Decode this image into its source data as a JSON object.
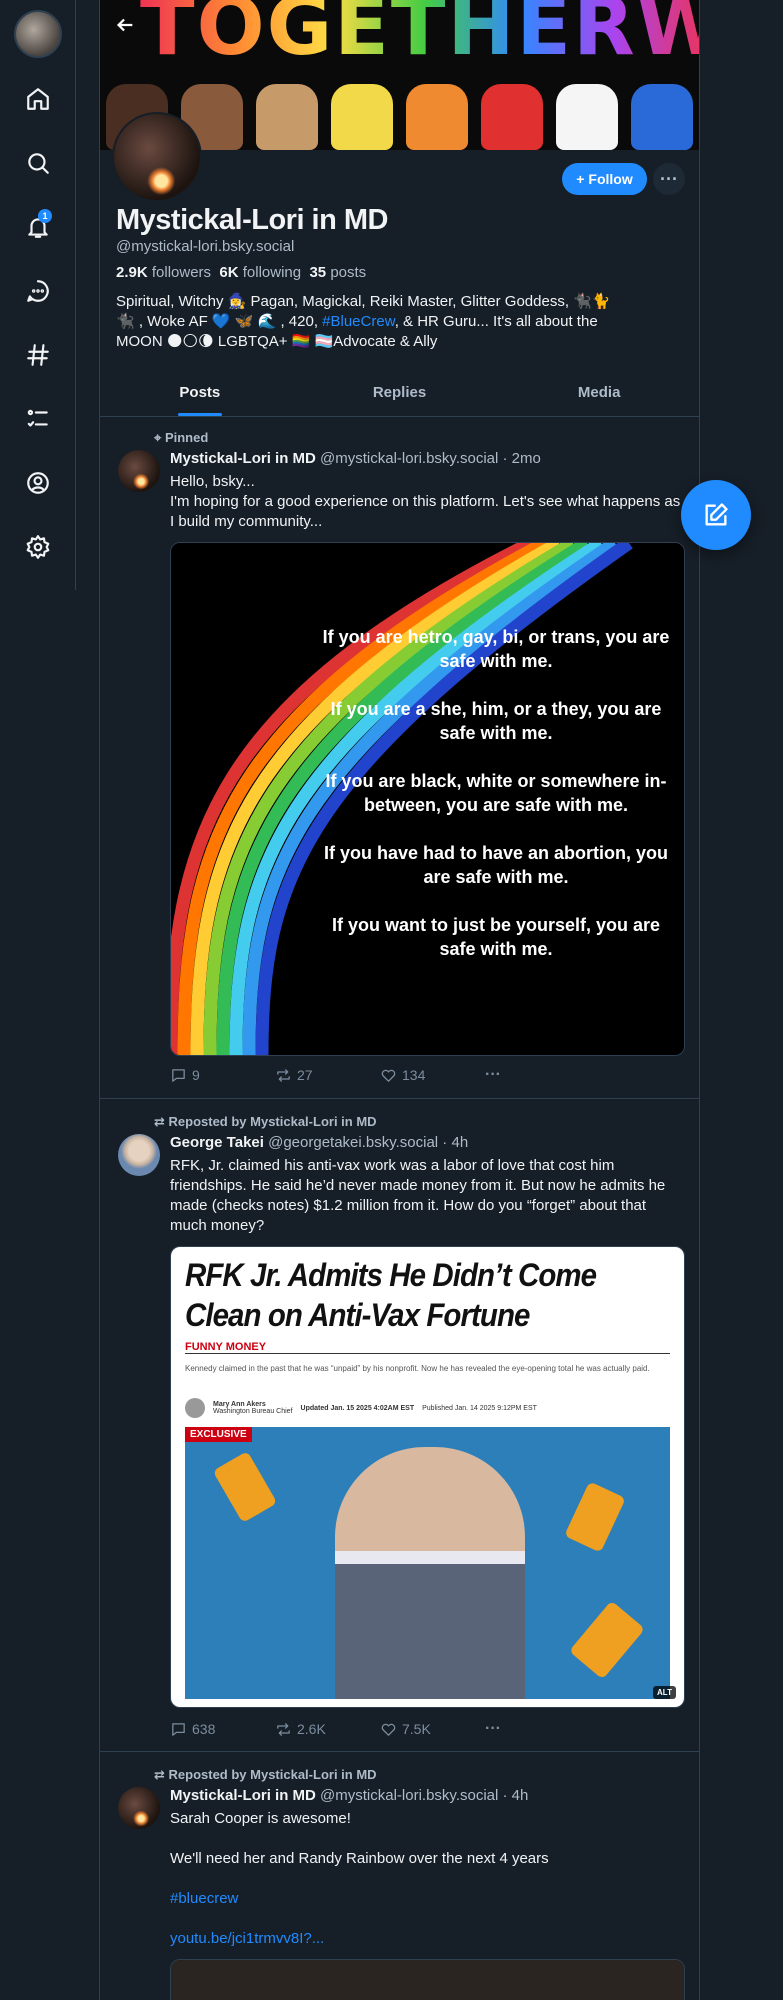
{
  "sidebar": {
    "notification_count": "1"
  },
  "profile": {
    "display_name": "Mystickal-Lori in MD",
    "handle": "@mystickal-lori.bsky.social",
    "followers_count": "2.9K",
    "followers_label": "followers",
    "following_count": "6K",
    "following_label": "following",
    "posts_count": "35",
    "posts_label": "posts",
    "follow_label": "Follow",
    "bio_line1": "Spiritual, Witchy 🧙‍♀️ Pagan, Magickal, Reiki Master,  Glitter Goddess, 🐈‍⬛🐈",
    "bio_line2_a": "🐈‍⬛ , Woke AF 💙 🦋 🌊 , 420, ",
    "bio_hashtag": "#BlueCrew",
    "bio_line2_b": ", & HR  Guru... It's all about the",
    "bio_line3": "MOON 🌑🌕🌘 LGBTQA+ 🏳️‍🌈 🏳️‍⚧️Advocate & Ally"
  },
  "tabs": [
    "Posts",
    "Replies",
    "Media"
  ],
  "posts": [
    {
      "context": "Pinned",
      "author": "Mystickal-Lori in MD",
      "handle": "@mystickal-lori.bsky.social · 2mo",
      "text_line1": "Hello, bsky...",
      "text_line2": "I'm hoping for a good experience on this platform. Let's see what happens as I build my community...",
      "image_lines": [
        "If you are hetro, gay, bi, or trans, you are safe with me.",
        "If you are a she, him, or a they, you are safe with me.",
        "If you are black, white or somewhere in-between, you are safe with me.",
        "If you have had to have an abortion, you are safe with me.",
        "If you want to just be yourself, you are safe with me."
      ],
      "replies": "9",
      "reposts": "27",
      "likes": "134"
    },
    {
      "context": "Reposted by Mystickal-Lori in MD",
      "author": "George Takei",
      "handle": "@georgetakei.bsky.social · 4h",
      "text": "RFK, Jr. claimed his anti-vax work was a labor of love that cost him friendships. He said he’d never made money from it. But now he admits he made (checks notes) $1.2 million from it. How do you “forget” about that much money?",
      "news_title": "RFK Jr. Admits He Didn’t Come Clean on Anti-Vax Fortune",
      "news_section": "FUNNY MONEY",
      "news_dek": "Kennedy claimed in the past that he was “unpaid” by his nonprofit. Now he has revealed the eye-opening total he was actually paid.",
      "news_author": "Mary Ann Akers",
      "news_author_title": "Washington Bureau Chief",
      "news_updated": "Updated Jan. 15 2025 4:02AM EST",
      "news_published": "Published Jan. 14 2025 9:12PM EST",
      "exclusive": "EXCLUSIVE",
      "alt": "ALT",
      "replies": "638",
      "reposts": "2.6K",
      "likes": "7.5K"
    },
    {
      "context": "Reposted by Mystickal-Lori in MD",
      "author": "Mystickal-Lori in MD",
      "handle": "@mystickal-lori.bsky.social · 4h",
      "text_line1": "Sarah Cooper is awesome!",
      "text_line2": "We'll need her and Randy Rainbow over the next 4 years",
      "hashtag": "#bluecrew",
      "link": "youtu.be/jci1trmvv8I?..."
    }
  ],
  "colors": {
    "background": "#161e27",
    "accent": "#208bfe",
    "border": "#2e4052",
    "muted_text": "#aebbc9"
  }
}
